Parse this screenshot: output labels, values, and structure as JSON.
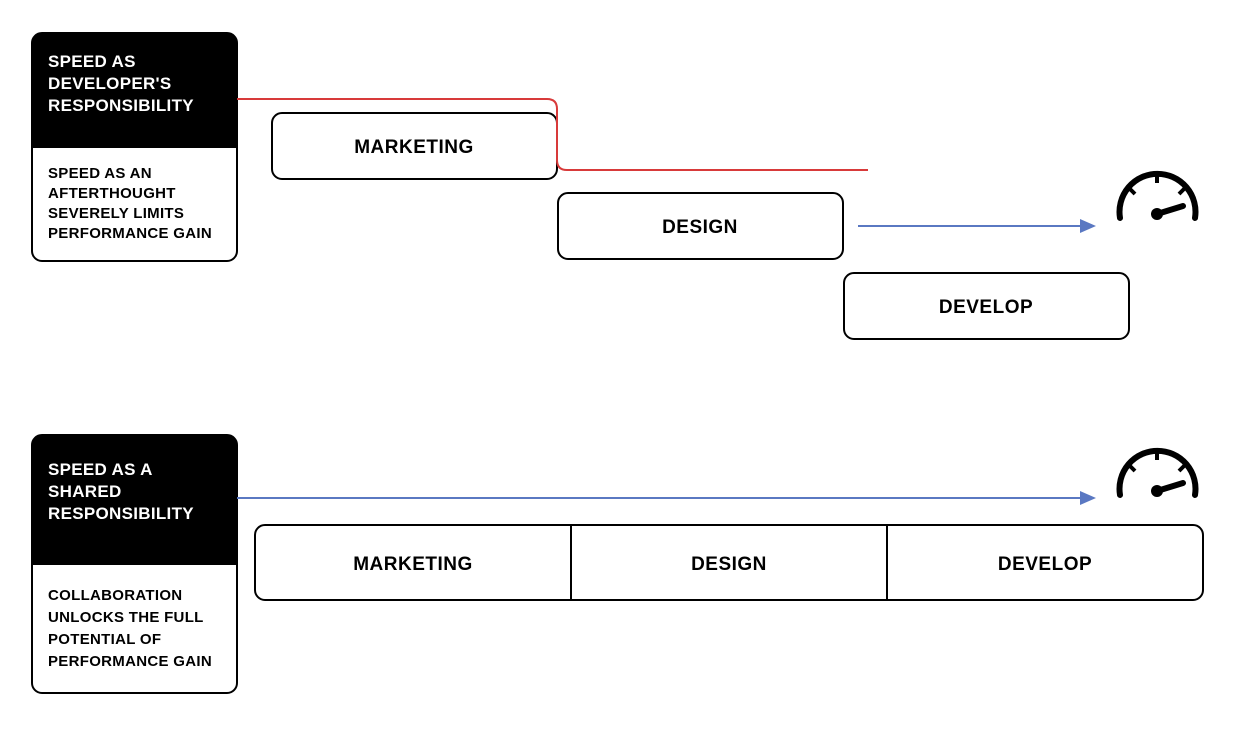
{
  "top": {
    "title": {
      "l1": "SPEED AS",
      "l2": "DEVELOPER'S",
      "l3": "RESPONSIBILITY"
    },
    "subtitle": {
      "l1": "SPEED AS AN",
      "l2": "AFTERTHOUGHT",
      "l3": "SEVERELY LIMITS",
      "l4": "PERFORMANCE GAIN"
    },
    "stages": {
      "a": "MARKETING",
      "b": "DESIGN",
      "c": "DEVELOP"
    }
  },
  "bottom": {
    "title": {
      "l1": "SPEED AS A",
      "l2": "SHARED",
      "l3": "RESPONSIBILITY"
    },
    "subtitle": {
      "l1": "COLLABORATION",
      "l2": "UNLOCKS THE FULL",
      "l3": "POTENTIAL OF",
      "l4": "PERFORMANCE GAIN"
    },
    "stages": {
      "a": "MARKETING",
      "b": "DESIGN",
      "c": "DEVELOP"
    }
  }
}
